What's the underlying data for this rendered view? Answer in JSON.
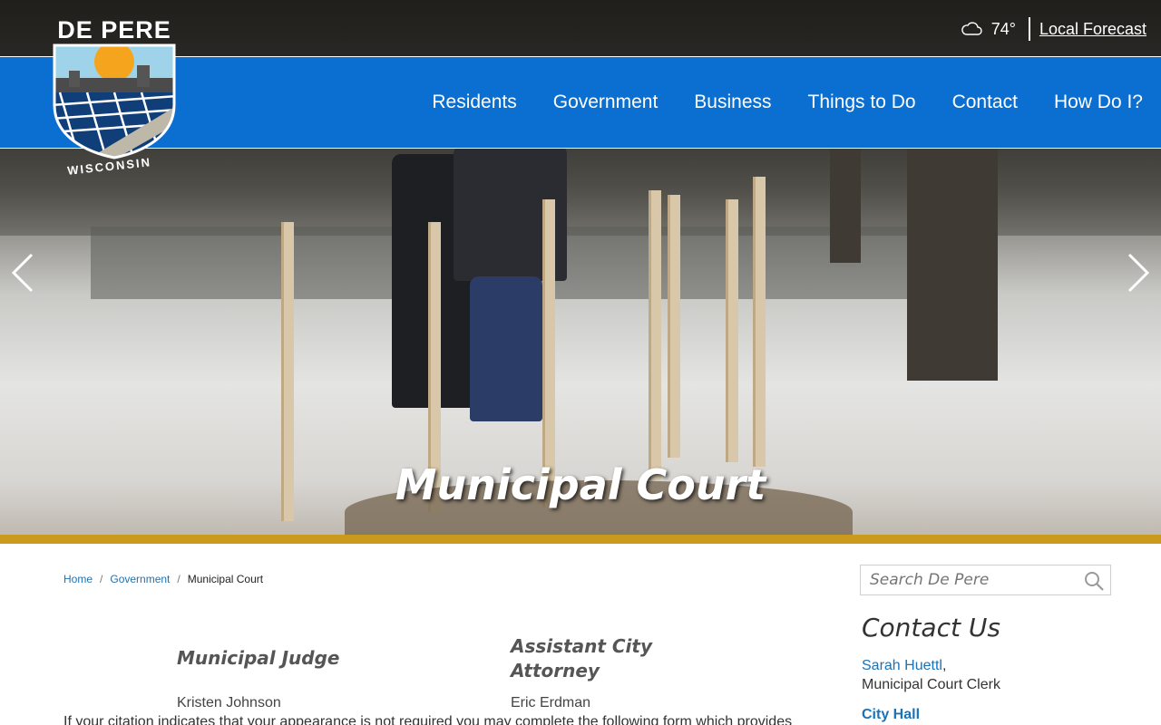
{
  "site": {
    "logo_wordmark": "DE PERE",
    "logo_state": "WISCONSIN"
  },
  "weather": {
    "icon": "cloud-icon",
    "temperature": "74°",
    "forecast_link": "Local Forecast"
  },
  "nav": {
    "items": [
      "Residents",
      "Government",
      "Business",
      "Things to Do",
      "Contact",
      "How Do I?"
    ]
  },
  "hero": {
    "title": "Municipal Court",
    "prev_icon": "chevron-left-icon",
    "next_icon": "chevron-right-icon"
  },
  "breadcrumb": {
    "home": "Home",
    "parent": "Government",
    "current": "Municipal Court"
  },
  "cards": [
    {
      "title": "Municipal Judge",
      "name": "Kristen Johnson"
    },
    {
      "title": "Assistant City Attorney",
      "title_line1": "Assistant City",
      "title_line2": "Attorney",
      "name": "Eric Erdman"
    }
  ],
  "body": {
    "intro": "If your citation indicates that your appearance is not required you may complete the following form which provides"
  },
  "sidebar": {
    "search_placeholder": "Search De Pere",
    "contact_heading": "Contact Us",
    "contact_name": "Sarah Huettl",
    "contact_role": "Municipal Court Clerk",
    "contact_location": "City Hall"
  },
  "colors": {
    "nav_blue": "#0a6fd1",
    "gold_band": "#c99a1c",
    "link_blue": "#1a73b8"
  }
}
